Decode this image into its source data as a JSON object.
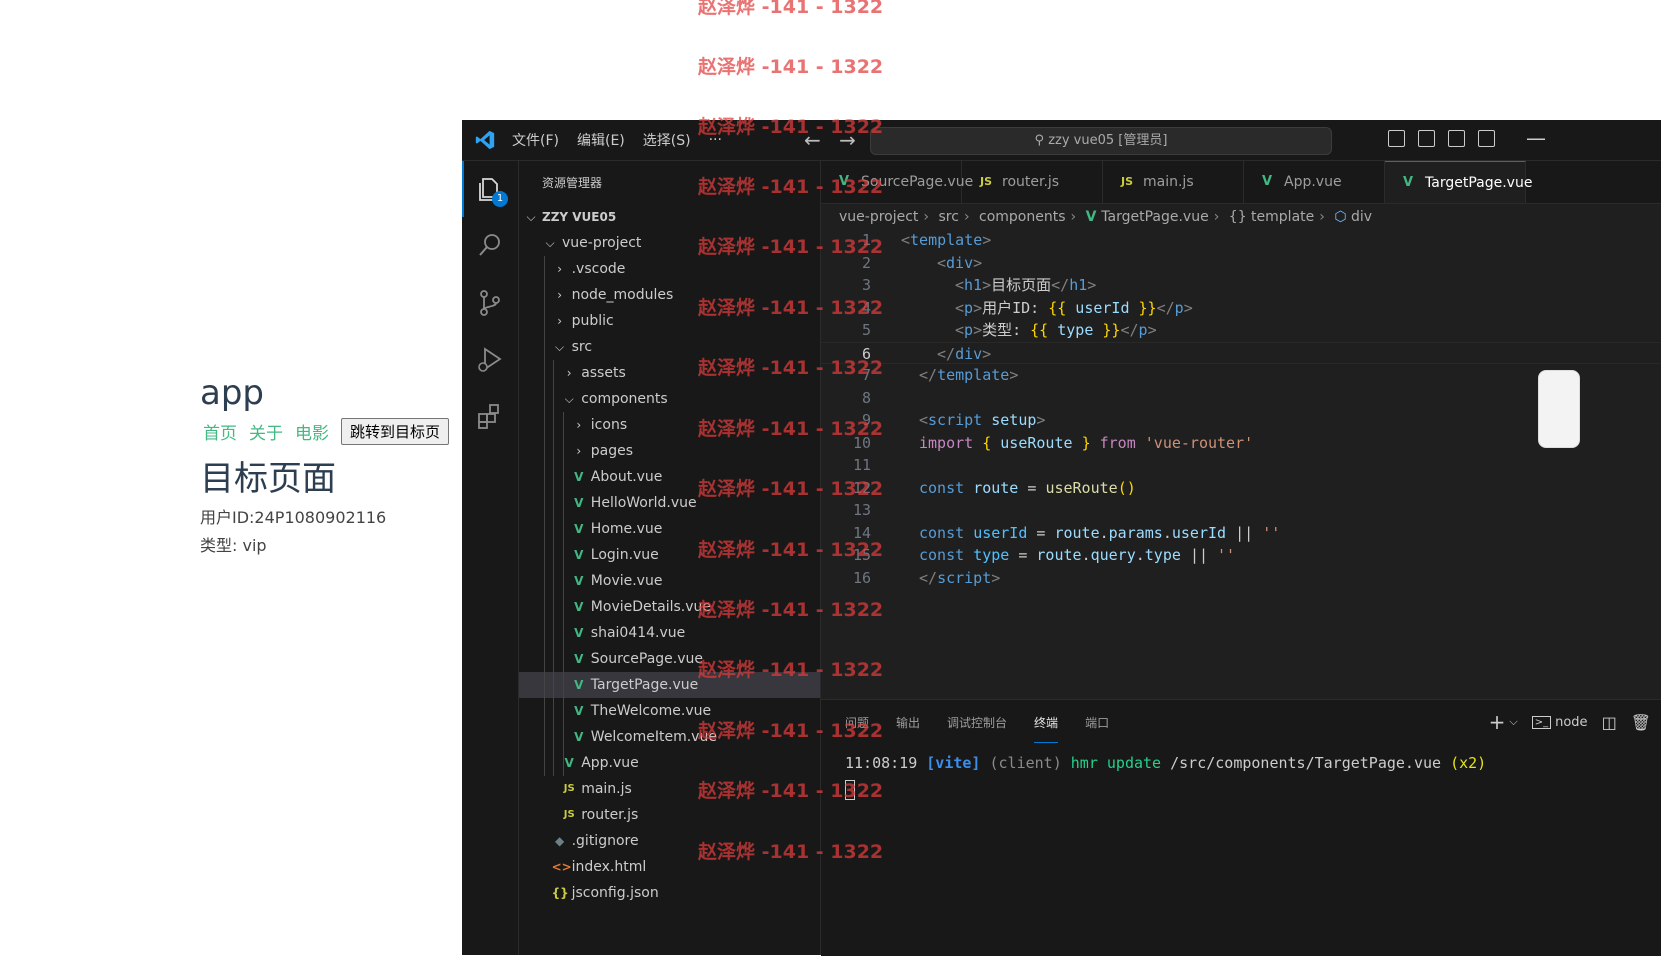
{
  "web_preview": {
    "app_title": "app",
    "nav_links": [
      "首页",
      "关于",
      "电影"
    ],
    "jump_button": "跳转到目标页",
    "page_heading": "目标页面",
    "user_id_line": "用户ID:24P1080902116",
    "type_line": "类型: vip"
  },
  "titlebar": {
    "menu": [
      "文件(F)",
      "编辑(E)",
      "选择(S)",
      "···"
    ],
    "back": "←",
    "forward": "→",
    "command_center": "zzy vue05 [管理员]",
    "minimize": "—"
  },
  "activitybar": {
    "explorer_badge": "1"
  },
  "explorer": {
    "title": "资源管理器",
    "workspace": "ZZY VUE05",
    "rows": [
      {
        "label": "vue-project",
        "type": "folder-open"
      },
      {
        "label": ".vscode",
        "type": "folder"
      },
      {
        "label": "node_modules",
        "type": "folder"
      },
      {
        "label": "public",
        "type": "folder"
      },
      {
        "label": "src",
        "type": "folder-open"
      },
      {
        "label": "assets",
        "type": "folder"
      },
      {
        "label": "components",
        "type": "folder-open"
      },
      {
        "label": "icons",
        "type": "folder"
      },
      {
        "label": "pages",
        "type": "folder"
      },
      {
        "label": "About.vue",
        "type": "vue"
      },
      {
        "label": "HelloWorld.vue",
        "type": "vue"
      },
      {
        "label": "Home.vue",
        "type": "vue"
      },
      {
        "label": "Login.vue",
        "type": "vue"
      },
      {
        "label": "Movie.vue",
        "type": "vue"
      },
      {
        "label": "MovieDetails.vue",
        "type": "vue"
      },
      {
        "label": "shai0414.vue",
        "type": "vue"
      },
      {
        "label": "SourcePage.vue",
        "type": "vue"
      },
      {
        "label": "TargetPage.vue",
        "type": "vue",
        "selected": true
      },
      {
        "label": "TheWelcome.vue",
        "type": "vue"
      },
      {
        "label": "WelcomeItem.vue",
        "type": "vue"
      },
      {
        "label": "App.vue",
        "type": "vue"
      },
      {
        "label": "main.js",
        "type": "js"
      },
      {
        "label": "router.js",
        "type": "js"
      },
      {
        "label": ".gitignore",
        "type": "git"
      },
      {
        "label": "index.html",
        "type": "html"
      },
      {
        "label": "jsconfig.json",
        "type": "json"
      }
    ]
  },
  "tabs": [
    {
      "label": "SourcePage.vue",
      "kind": "vue"
    },
    {
      "label": "router.js",
      "kind": "js"
    },
    {
      "label": "main.js",
      "kind": "js"
    },
    {
      "label": "App.vue",
      "kind": "vue"
    },
    {
      "label": "TargetPage.vue",
      "kind": "vue",
      "active": true
    }
  ],
  "breadcrumb": [
    "vue-project",
    "src",
    "components",
    "TargetPage.vue",
    "{} template",
    "div"
  ],
  "code_lines": [
    "1",
    "2",
    "3",
    "4",
    "5",
    "6",
    "7",
    "8",
    "9",
    "10",
    "11",
    "12",
    "13",
    "14",
    "15",
    "16"
  ],
  "panel": {
    "tabs": [
      "问题",
      "输出",
      "调试控制台",
      "终端",
      "端口"
    ],
    "active_tab": "终端",
    "add": "+",
    "terminal_name": "node",
    "terminal_output": {
      "time": "11:08:19",
      "tag": "[vite]",
      "client": "(client)",
      "hmr": "hmr update",
      "path": "/src/components/TargetPage.vue",
      "count": "(x2)"
    }
  },
  "watermark": "赵泽烨 -141 - 1322"
}
